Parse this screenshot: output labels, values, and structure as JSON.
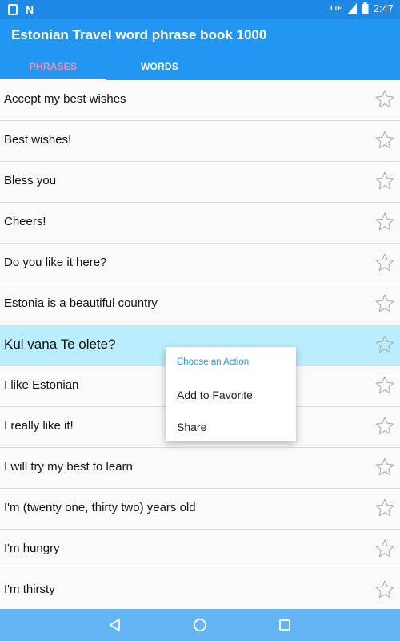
{
  "status_bar": {
    "time": "2:47",
    "network": "LTE"
  },
  "app": {
    "title": "Estonian Travel word phrase book 1000"
  },
  "tabs": [
    {
      "label": "PHRASES",
      "active": true
    },
    {
      "label": "WORDS",
      "active": false
    }
  ],
  "phrases": [
    "Accept my best wishes",
    "Best wishes!",
    "Bless you",
    "Cheers!",
    "Do you like it here?",
    "Estonia is a beautiful country",
    "Kui vana Te olete?",
    "I like Estonian",
    "I really like it!",
    "I will try my best to learn",
    "I'm (twenty one, thirty two) years old",
    "I'm hungry",
    "I'm thirsty"
  ],
  "selected_index": 6,
  "context_menu": {
    "title": "Choose an Action",
    "items": [
      "Add to Favorite",
      "Share"
    ]
  },
  "colors": {
    "status_bar": "#1e88e5",
    "app_bar": "#2196f3",
    "active_tab": "#f48fb1",
    "selected_row": "#bbeefc",
    "nav_bar": "#64b5f6"
  }
}
